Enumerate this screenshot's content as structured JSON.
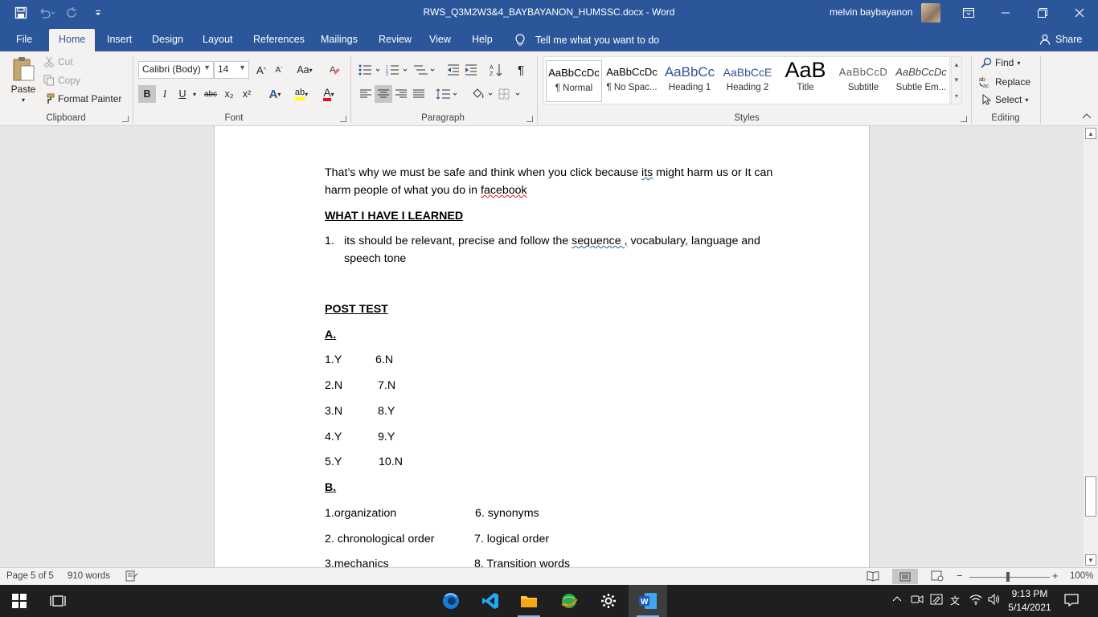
{
  "title_bar": {
    "document_title": "RWS_Q3M2W3&4_BAYBAYANON_HUMSSC.docx  -  Word",
    "user_name": "melvin baybayanon",
    "qat_icons": [
      "save-icon",
      "undo-icon",
      "redo-icon",
      "customize-qat-icon"
    ],
    "window_controls": [
      "ribbon-display-options-icon",
      "minimize-icon",
      "restore-icon",
      "close-icon"
    ]
  },
  "tabs": {
    "items": [
      "File",
      "Home",
      "Insert",
      "Design",
      "Layout",
      "References",
      "Mailings",
      "Review",
      "View",
      "Help"
    ],
    "active": "Home",
    "tell_me": "Tell me what you want to do",
    "share": "Share"
  },
  "ribbon": {
    "clipboard": {
      "label": "Clipboard",
      "paste": "Paste",
      "cut": "Cut",
      "copy": "Copy",
      "format_painter": "Format Painter"
    },
    "font": {
      "label": "Font",
      "font_name": "Calibri (Body)",
      "font_size": "14",
      "bold": "B",
      "italic": "I",
      "underline": "U",
      "strikethrough": "abc",
      "subscript": "x₂",
      "superscript": "x²",
      "grow": "A",
      "shrink": "A",
      "change_case": "Aa",
      "font_color_letter": "A",
      "text_effects_letter": "A",
      "highlight_letters": "ab"
    },
    "paragraph": {
      "label": "Paragraph"
    },
    "styles": {
      "label": "Styles",
      "items": [
        {
          "preview": "AaBbCcDc",
          "name": "¶ Normal"
        },
        {
          "preview": "AaBbCcDc",
          "name": "¶ No Spac..."
        },
        {
          "preview": "AaBbCc",
          "name": "Heading 1"
        },
        {
          "preview": "AaBbCcE",
          "name": "Heading 2"
        },
        {
          "preview": "AaB",
          "name": "Title"
        },
        {
          "preview": "AaBbCcD",
          "name": "Subtitle"
        },
        {
          "preview": "AaBbCcDc",
          "name": "Subtle Em..."
        }
      ]
    },
    "editing": {
      "label": "Editing",
      "find": "Find",
      "replace": "Replace",
      "select": "Select"
    }
  },
  "document": {
    "para1_line1": "That’s why we must be safe and think when you click because ",
    "para1_its": "its",
    "para1_line1_rest": " might harm us or It can",
    "para1_line2": "harm people of what you do in ",
    "para1_facebook": "facebook",
    "learned_heading": "WHAT I HAVE I LEARNED",
    "list_number": "1.",
    "list_text_a": "its should be relevant, precise and follow the ",
    "list_sequence": "sequence ,",
    "list_text_b": " vocabulary, language and",
    "list_text_c": "speech tone",
    "post_test_heading": "POST TEST",
    "section_a": "A.",
    "answers_a": [
      [
        "1.Y",
        "6.N"
      ],
      [
        "2.N",
        "7.N"
      ],
      [
        "3.N",
        "8.Y"
      ],
      [
        "4.Y",
        "9.Y"
      ],
      [
        "5.Y",
        "10.N"
      ]
    ],
    "section_b": "B.",
    "answers_b": [
      [
        "1.organization",
        "6. synonyms"
      ],
      [
        "2. chronological order",
        "7. logical order"
      ],
      [
        "3.mechanics",
        "8. Transition words"
      ]
    ]
  },
  "status_bar": {
    "page": "Page 5 of 5",
    "words": "910 words",
    "zoom": "100%",
    "zoom_minus": "−",
    "zoom_plus": "+"
  },
  "taskbar": {
    "time": "9:13 PM",
    "date": "5/14/2021",
    "language": "文"
  }
}
